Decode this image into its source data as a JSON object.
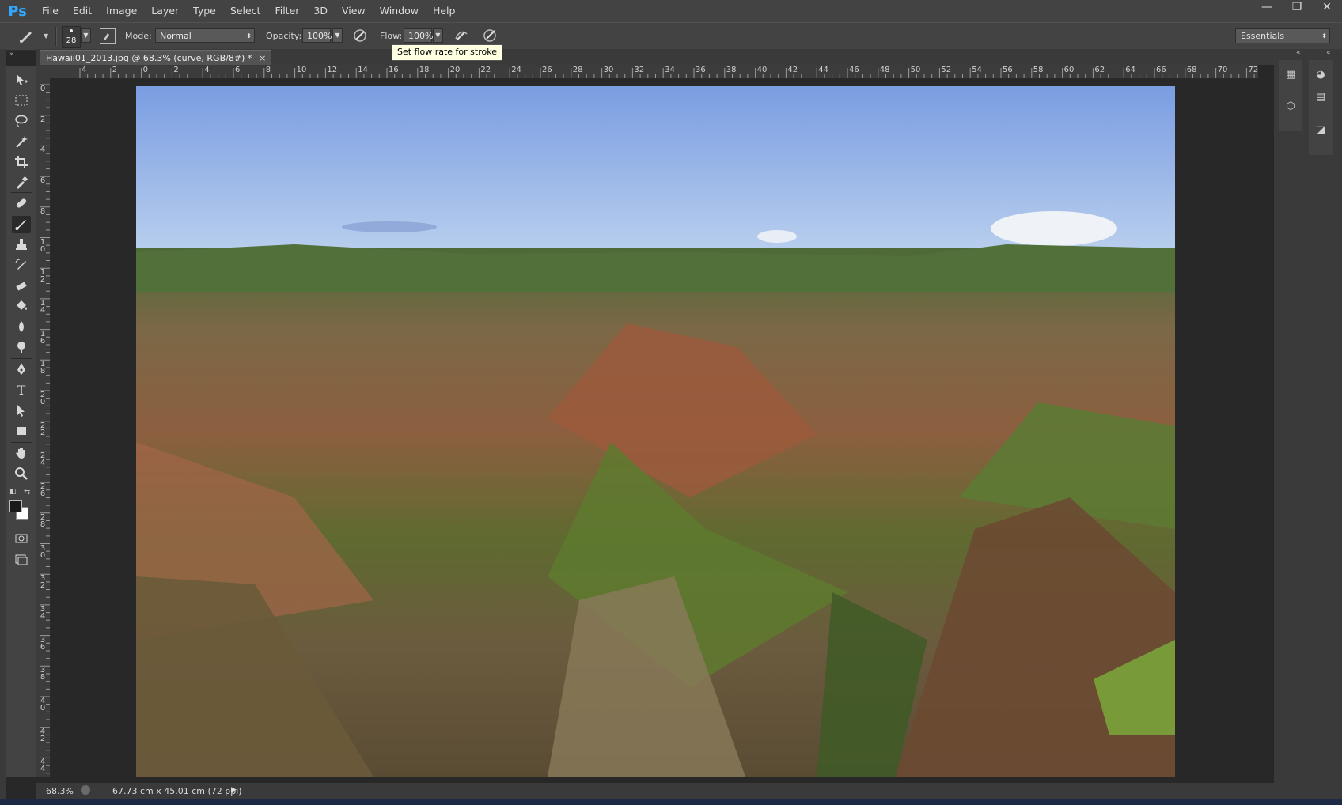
{
  "app": {
    "logo": "Ps"
  },
  "menu": [
    "File",
    "Edit",
    "Image",
    "Layer",
    "Type",
    "Select",
    "Filter",
    "3D",
    "View",
    "Window",
    "Help"
  ],
  "window_controls": {
    "minimize": "—",
    "restore": "❐",
    "close": "✕"
  },
  "options": {
    "brush_size": "28",
    "mode_label": "Mode:",
    "mode_value": "Normal",
    "opacity_label": "Opacity:",
    "opacity_value": "100%",
    "flow_label": "Flow:",
    "flow_value": "100%",
    "tooltip": "Set flow rate for stroke",
    "workspace": "Essentials"
  },
  "document": {
    "tab_title": "Hawaii01_2013.jpg @ 68.3% (curve, RGB/8#) *",
    "close": "×"
  },
  "ruler": {
    "h_ticks": [
      "4",
      "2",
      "0",
      "2",
      "4",
      "6",
      "8",
      "10",
      "12",
      "14",
      "16",
      "18",
      "20",
      "22",
      "24",
      "26",
      "28",
      "30",
      "32",
      "34",
      "36",
      "38",
      "40",
      "42",
      "44",
      "46",
      "48",
      "50",
      "52",
      "54",
      "56",
      "58",
      "60",
      "62",
      "64",
      "66",
      "68",
      "70",
      "72"
    ],
    "v_ticks": [
      "0",
      "2",
      "4",
      "6",
      "8",
      "1 0",
      "1 2",
      "1 4",
      "1 6",
      "1 8",
      "2 0",
      "2 2",
      "2 4",
      "2 6",
      "2 8",
      "3 0",
      "3 2",
      "3 4",
      "3 6",
      "3 8",
      "4 0",
      "4 2",
      "4 4"
    ]
  },
  "status": {
    "zoom": "68.3%",
    "doc_size": "67.73 cm x 45.01 cm (72 ppi)"
  },
  "tools": [
    "move-tool",
    "marquee-tool",
    "lasso-tool",
    "magic-wand-tool",
    "crop-tool",
    "eyedropper-tool",
    "healing-brush-tool",
    "brush-tool",
    "clone-stamp-tool",
    "history-brush-tool",
    "eraser-tool",
    "paint-bucket-tool",
    "blur-tool",
    "dodge-tool",
    "pen-tool",
    "type-tool",
    "path-selection-tool",
    "rectangle-tool",
    "hand-tool",
    "zoom-tool"
  ]
}
